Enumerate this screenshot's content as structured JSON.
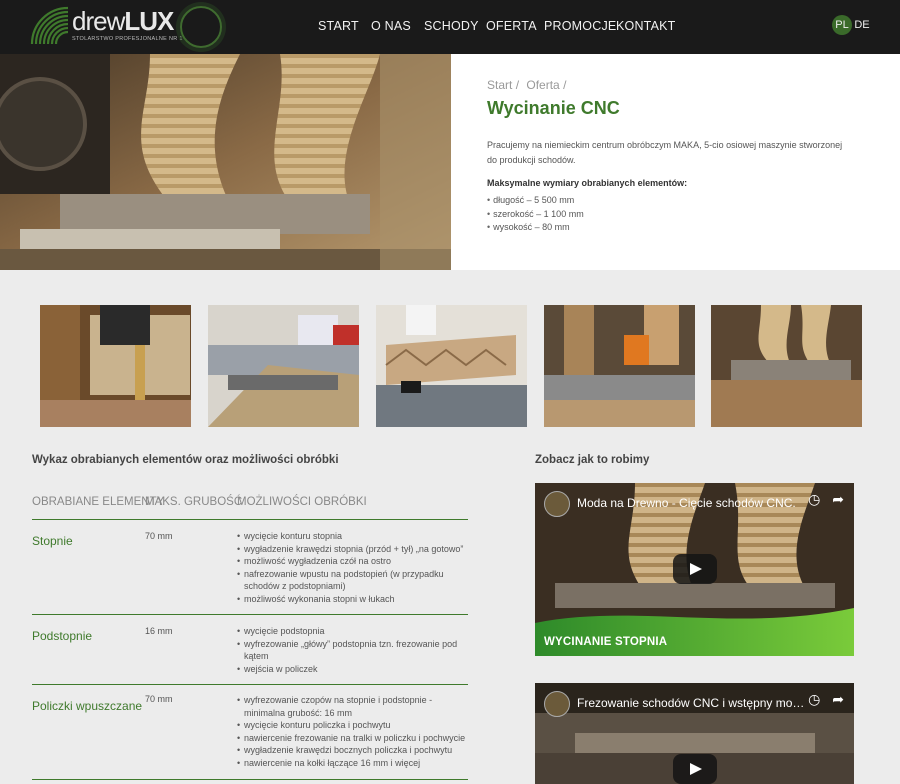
{
  "brand": {
    "name_part1": "drew",
    "name_part2": "LUX",
    "tagline": "STOLARSTWO PROFESJONALNE  NR 1"
  },
  "nav": {
    "items": [
      "Start",
      "O nas",
      "Schody",
      "Oferta",
      "Promocje",
      "Kontakt"
    ],
    "active": "Oferta"
  },
  "lang": {
    "pl": "PL",
    "de": "DE"
  },
  "breadcrumb": [
    "Start",
    "/",
    "Oferta",
    "/"
  ],
  "page": {
    "title": "Wycinanie CNC",
    "intro": "Pracujemy na niemieckim centrum obróbczym MAKA, 5-cio osiowej maszynie stworzonej do produkcji schodów.",
    "dims_title": "Maksymalne wymiary obrabianych elementów:",
    "dims": [
      "długość – 5 500 mm",
      "szerokość – 1 100 mm",
      "wysokość – 80 mm"
    ]
  },
  "table": {
    "title": "Wykaz obrabianych elementów oraz możliwości obróbki",
    "headers": [
      "Obrabiane elementy",
      "Maks. grubość",
      "Możliwości obróbki"
    ],
    "rows": [
      {
        "name": "Stopnie",
        "thickness": "70 mm",
        "ops": [
          "wycięcie konturu stopnia",
          "wygładzenie krawędzi stopnia (przód + tył) „na gotowo”",
          "możliwość wygładzenia czół na ostro",
          "nafrezowanie wpustu na podstopień (w przypadku schodów z podstopniami)",
          "możliwość wykonania stopni w łukach"
        ]
      },
      {
        "name": "Podstopnie",
        "thickness": "16 mm",
        "ops": [
          "wycięcie podstopnia",
          "wyfrezowanie „główy” podstopnia tzn. frezowanie pod kątem",
          "wejścia w policzek"
        ]
      },
      {
        "name": "Policzki wpuszczane",
        "thickness": "70 mm",
        "ops": [
          "wyfrezowanie czopów na stopnie i podstopnie - minimalna grubość: 16 mm",
          "wycięcie konturu policzka i pochwytu",
          "nawiercenie frezowanie na tralki w policzku i pochwycie",
          "wygładzenie krawędzi bocznych policzka i pochwytu",
          "nawiercenie na kołki łączące 16 mm i więcej"
        ]
      }
    ]
  },
  "videos": {
    "title": "Zobacz jak to robimy",
    "items": [
      {
        "title": "Moda na Drewno - Cięcie schodów CNC.",
        "caption": "WYCINANIE STOPNIA"
      },
      {
        "title": "Frezowanie schodów CNC i wstępny mo…",
        "caption": ""
      }
    ]
  },
  "colors": {
    "accent": "#3f7a2c",
    "header_bg": "#1a1a1a",
    "page_bg": "#ececec"
  }
}
